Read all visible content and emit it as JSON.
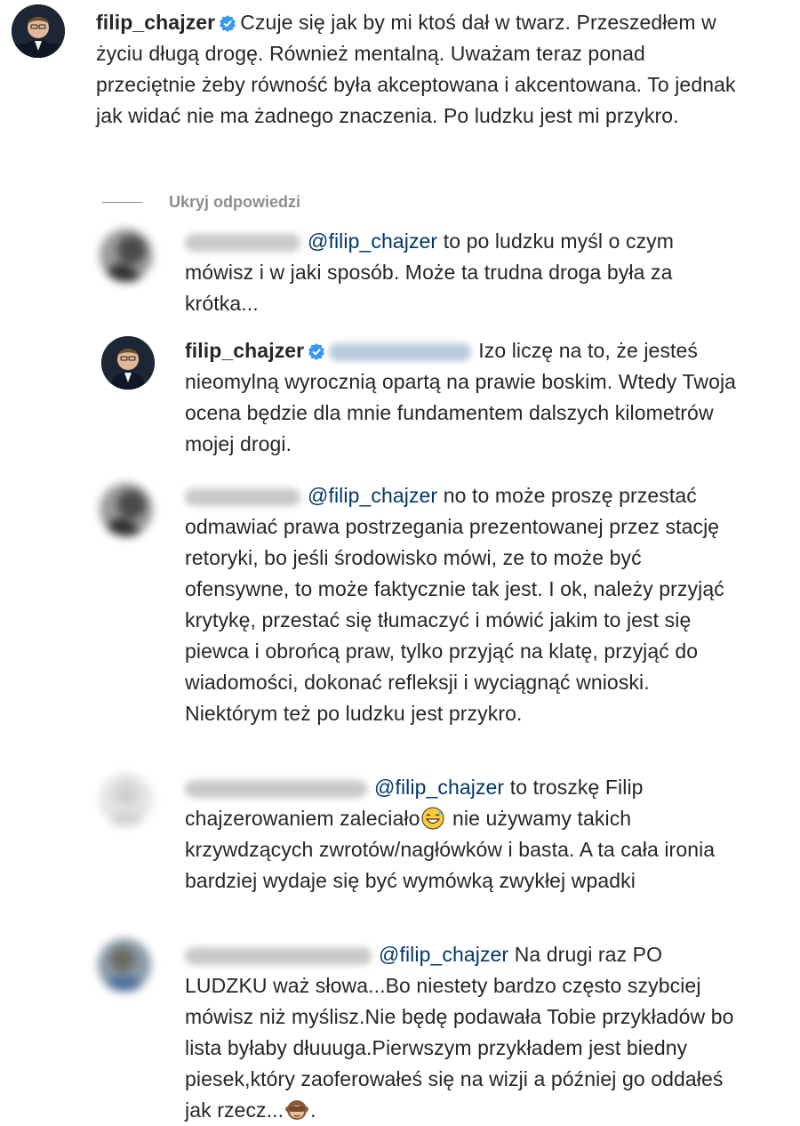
{
  "main_comment": {
    "username": "filip_chajzer",
    "text": "Czuje się jak by mi ktoś dał w twarz. Przeszedłem w życiu długą drogę. Również mentalną. Uważam teraz ponad przeciętnie żeby równość była akceptowana i akcentowana. To jednak jak widać nie ma żadnego znaczenia. Po ludzku jest mi przykro."
  },
  "hide_replies_label": "Ukryj odpowiedzi",
  "replies": [
    {
      "mention": "@filip_chajzer",
      "text": "to po ludzku myśl o czym mówisz i w jaki sposób. Może ta trudna droga była za krótka..."
    },
    {
      "username": "filip_chajzer",
      "text": "Izo liczę na to, że jesteś nieomylną wyrocznią opartą na prawie boskim. Wtedy Twoja ocena będzie dla mnie fundamentem dalszych kilometrów mojej drogi."
    },
    {
      "mention": "@filip_chajzer",
      "text": "no to może proszę przestać odmawiać prawa postrzegania prezentowanej przez stację retoryki, bo jeśli środowisko mówi, ze to może być ofensywne, to może faktycznie tak jest. I ok, należy przyjąć krytykę, przestać się tłumaczyć i mówić jakim to jest się piewca i obrońcą praw, tylko przyjąć na klatę, przyjąć do wiadomości, dokonać refleksji i wyciągnąć wnioski. Niektórym też po ludzku jest przykro."
    },
    {
      "mention": "@filip_chajzer",
      "text_before_emoji": "to troszkę Filip chajzerowaniem zaleciało",
      "text_after_emoji": "nie używamy takich krzywdzących zwrotów/nagłówków i basta. A ta cała ironia bardziej wydaje się być wymówką zwykłej wpadki"
    },
    {
      "mention": "@filip_chajzer",
      "text": "Na drugi raz PO LUDZKU waż słowa...Bo niestety bardzo często szybciej mówisz niż myślisz.Nie będę podawała Tobie przykładów bo lista byłaby dłuuuga.Pierwszym przykładem jest biedny piesek,który zaoferowałeś się na wizji a później go oddałeś jak rzecz...",
      "trailing": "."
    }
  ]
}
